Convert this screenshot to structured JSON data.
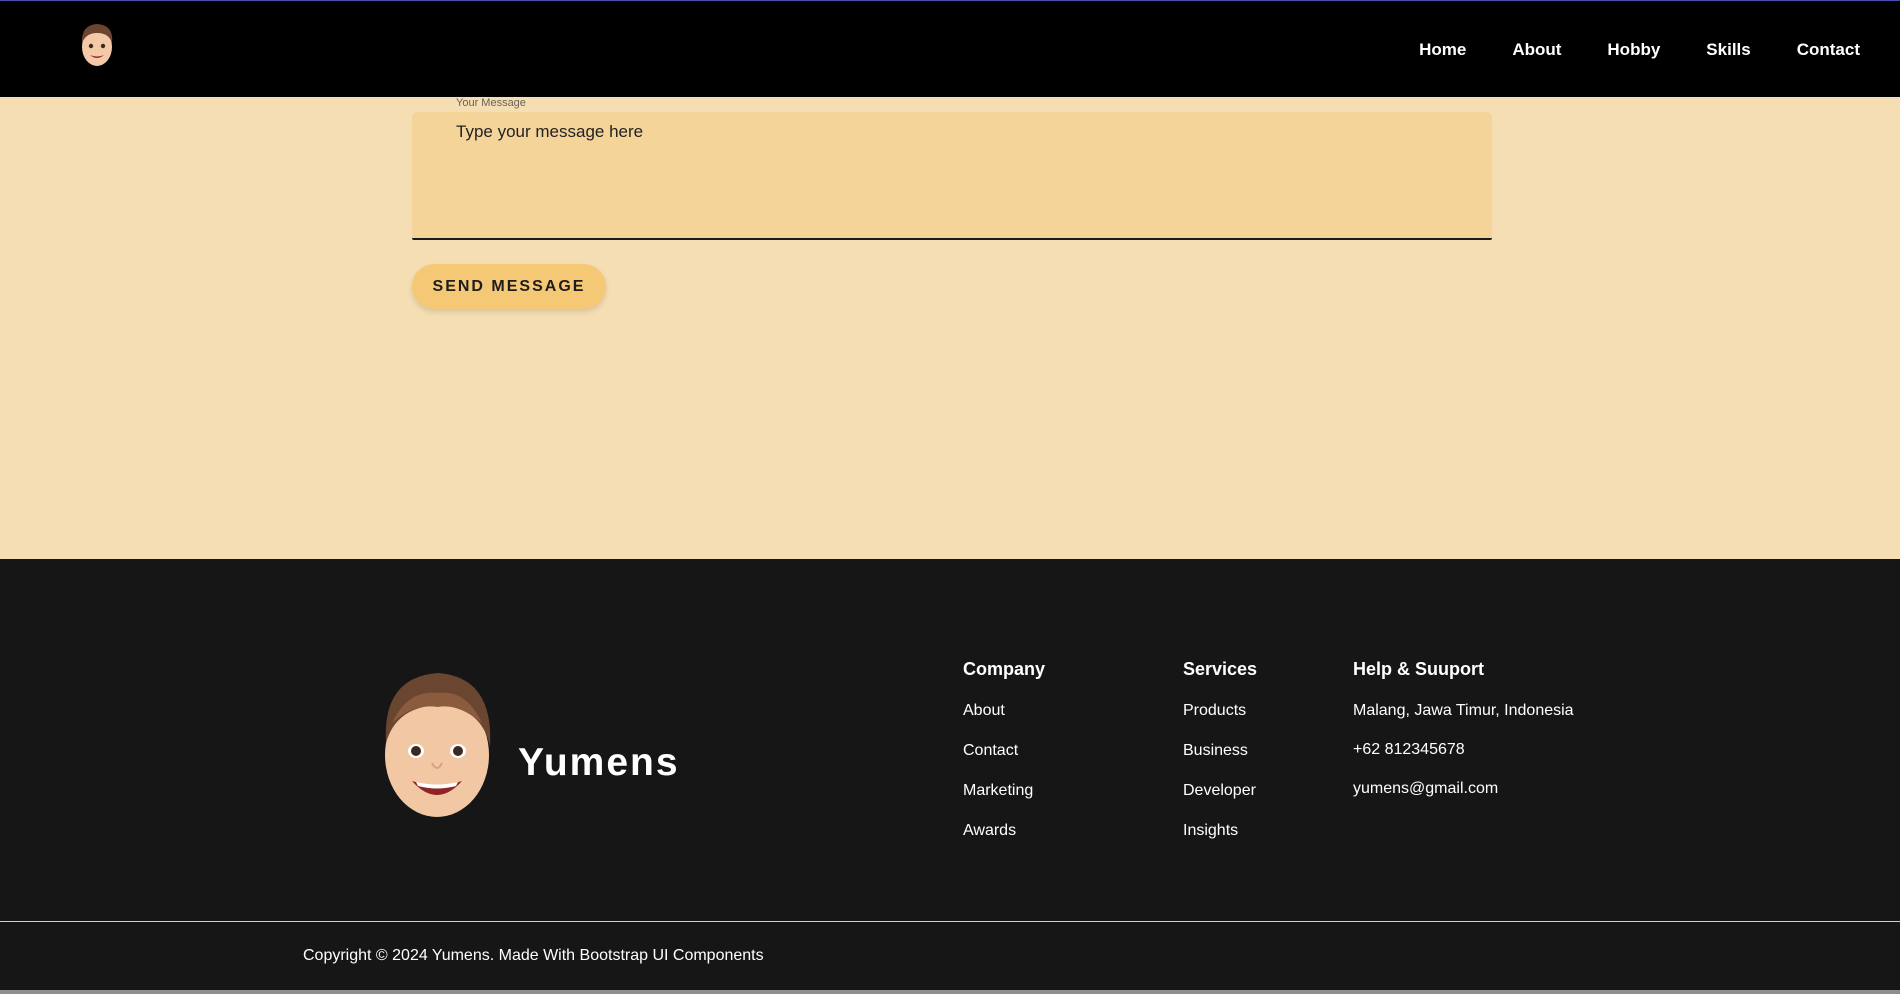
{
  "nav": {
    "items": [
      "Home",
      "About",
      "Hobby",
      "Skills",
      "Contact"
    ]
  },
  "contact": {
    "message_label": "Your Message",
    "message_placeholder": "Type your message here",
    "send_label": "SEND MESSAGE"
  },
  "footer": {
    "brand": "Yumens",
    "company": {
      "title": "Company",
      "links": [
        "About",
        "Contact",
        "Marketing",
        "Awards"
      ]
    },
    "services": {
      "title": "Services",
      "links": [
        "Products",
        "Business",
        "Developer",
        "Insights"
      ]
    },
    "help": {
      "title": "Help & Suuport",
      "address": "Malang, Jawa Timur, Indonesia",
      "phone": "+62 812345678",
      "email": "yumens@gmail.com"
    },
    "copyright": "Copyright © 2024 Yumens. Made With Bootstrap UI Components"
  },
  "colors": {
    "page_bg": "#f5deb3",
    "textarea_bg": "#f5d49a",
    "button_bg": "#f5c876",
    "footer_bg": "#161616",
    "nav_bg": "#000000"
  }
}
